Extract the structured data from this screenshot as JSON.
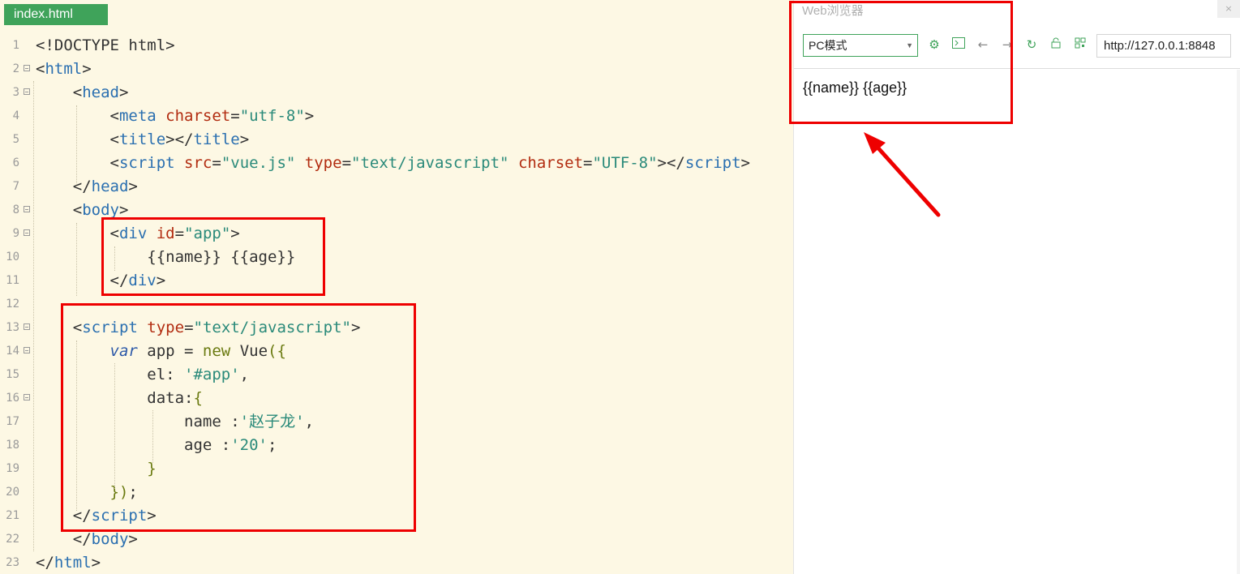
{
  "editor": {
    "tab_label": "index.html",
    "lines": [
      {
        "num": "1",
        "fold": false,
        "tokens": [
          {
            "c": "d",
            "t": "<!DOCTYPE html>"
          }
        ]
      },
      {
        "num": "2",
        "fold": true,
        "tokens": [
          {
            "c": "d",
            "t": "<"
          },
          {
            "c": "t",
            "t": "html"
          },
          {
            "c": "d",
            "t": ">"
          }
        ]
      },
      {
        "num": "3",
        "fold": true,
        "tokens": [
          {
            "c": "d",
            "t": "    <"
          },
          {
            "c": "t",
            "t": "head"
          },
          {
            "c": "d",
            "t": ">"
          }
        ]
      },
      {
        "num": "4",
        "fold": false,
        "tokens": [
          {
            "c": "d",
            "t": "        <"
          },
          {
            "c": "t",
            "t": "meta"
          },
          {
            "c": "d",
            "t": " "
          },
          {
            "c": "a",
            "t": "charset"
          },
          {
            "c": "d",
            "t": "="
          },
          {
            "c": "s",
            "t": "\"utf-8\""
          },
          {
            "c": "d",
            "t": ">"
          }
        ]
      },
      {
        "num": "5",
        "fold": false,
        "tokens": [
          {
            "c": "d",
            "t": "        <"
          },
          {
            "c": "t",
            "t": "title"
          },
          {
            "c": "d",
            "t": "></"
          },
          {
            "c": "t",
            "t": "title"
          },
          {
            "c": "d",
            "t": ">"
          }
        ]
      },
      {
        "num": "6",
        "fold": false,
        "tokens": [
          {
            "c": "d",
            "t": "        <"
          },
          {
            "c": "t",
            "t": "script"
          },
          {
            "c": "d",
            "t": " "
          },
          {
            "c": "a",
            "t": "src"
          },
          {
            "c": "d",
            "t": "="
          },
          {
            "c": "s",
            "t": "\"vue.js\""
          },
          {
            "c": "d",
            "t": " "
          },
          {
            "c": "a",
            "t": "type"
          },
          {
            "c": "d",
            "t": "="
          },
          {
            "c": "s",
            "t": "\"text/javascript\""
          },
          {
            "c": "d",
            "t": " "
          },
          {
            "c": "a",
            "t": "charset"
          },
          {
            "c": "d",
            "t": "="
          },
          {
            "c": "s",
            "t": "\"UTF-8\""
          },
          {
            "c": "d",
            "t": "></"
          },
          {
            "c": "t",
            "t": "script"
          },
          {
            "c": "d",
            "t": ">"
          }
        ]
      },
      {
        "num": "7",
        "fold": false,
        "tokens": [
          {
            "c": "d",
            "t": "    </"
          },
          {
            "c": "t",
            "t": "head"
          },
          {
            "c": "d",
            "t": ">"
          }
        ]
      },
      {
        "num": "8",
        "fold": true,
        "tokens": [
          {
            "c": "d",
            "t": "    <"
          },
          {
            "c": "t",
            "t": "body"
          },
          {
            "c": "d",
            "t": ">"
          }
        ]
      },
      {
        "num": "9",
        "fold": true,
        "tokens": [
          {
            "c": "d",
            "t": "        <"
          },
          {
            "c": "t",
            "t": "div"
          },
          {
            "c": "d",
            "t": " "
          },
          {
            "c": "a",
            "t": "id"
          },
          {
            "c": "d",
            "t": "="
          },
          {
            "c": "s",
            "t": "\"app\""
          },
          {
            "c": "d",
            "t": ">"
          }
        ]
      },
      {
        "num": "10",
        "fold": false,
        "tokens": [
          {
            "c": "d",
            "t": "            {{name}} {{age}}"
          }
        ]
      },
      {
        "num": "11",
        "fold": false,
        "tokens": [
          {
            "c": "d",
            "t": "        </"
          },
          {
            "c": "t",
            "t": "div"
          },
          {
            "c": "d",
            "t": ">"
          }
        ]
      },
      {
        "num": "12",
        "fold": false,
        "tokens": []
      },
      {
        "num": "13",
        "fold": true,
        "tokens": [
          {
            "c": "d",
            "t": "    <"
          },
          {
            "c": "t",
            "t": "script"
          },
          {
            "c": "d",
            "t": " "
          },
          {
            "c": "a",
            "t": "type"
          },
          {
            "c": "d",
            "t": "="
          },
          {
            "c": "s",
            "t": "\"text/javascript\""
          },
          {
            "c": "d",
            "t": ">"
          }
        ]
      },
      {
        "num": "14",
        "fold": true,
        "tokens": [
          {
            "c": "d",
            "t": "        "
          },
          {
            "c": "k",
            "t": "var"
          },
          {
            "c": "d",
            "t": " app = "
          },
          {
            "c": "p",
            "t": "new"
          },
          {
            "c": "d",
            "t": " Vue"
          },
          {
            "c": "p",
            "t": "({"
          }
        ]
      },
      {
        "num": "15",
        "fold": false,
        "tokens": [
          {
            "c": "d",
            "t": "            el: "
          },
          {
            "c": "s",
            "t": "'#app'"
          },
          {
            "c": "d",
            "t": ","
          }
        ]
      },
      {
        "num": "16",
        "fold": true,
        "tokens": [
          {
            "c": "d",
            "t": "            data:"
          },
          {
            "c": "p",
            "t": "{"
          }
        ]
      },
      {
        "num": "17",
        "fold": false,
        "tokens": [
          {
            "c": "d",
            "t": "                name :"
          },
          {
            "c": "s",
            "t": "'赵子龙'"
          },
          {
            "c": "d",
            "t": ","
          }
        ]
      },
      {
        "num": "18",
        "fold": false,
        "tokens": [
          {
            "c": "d",
            "t": "                age :"
          },
          {
            "c": "s",
            "t": "'20'"
          },
          {
            "c": "d",
            "t": ";"
          }
        ]
      },
      {
        "num": "19",
        "fold": false,
        "tokens": [
          {
            "c": "p",
            "t": "            }"
          }
        ]
      },
      {
        "num": "20",
        "fold": false,
        "tokens": [
          {
            "c": "p",
            "t": "        })"
          },
          {
            "c": "d",
            "t": ";"
          }
        ]
      },
      {
        "num": "21",
        "fold": false,
        "tokens": [
          {
            "c": "d",
            "t": "    </"
          },
          {
            "c": "t",
            "t": "script"
          },
          {
            "c": "d",
            "t": ">"
          }
        ]
      },
      {
        "num": "22",
        "fold": false,
        "tokens": [
          {
            "c": "d",
            "t": "    </"
          },
          {
            "c": "t",
            "t": "body"
          },
          {
            "c": "d",
            "t": ">"
          }
        ]
      },
      {
        "num": "23",
        "fold": false,
        "tokens": [
          {
            "c": "d",
            "t": "</"
          },
          {
            "c": "t",
            "t": "html"
          },
          {
            "c": "d",
            "t": ">"
          }
        ]
      }
    ]
  },
  "browser": {
    "title": "Web浏览器",
    "close_label": "×",
    "mode_value": "PC模式",
    "url_value": "http://127.0.0.1:8848",
    "rendered_text": "{{name}} {{age}}",
    "toolbar_icons": [
      "settings-icon",
      "console-icon",
      "back-icon",
      "forward-icon",
      "refresh-icon",
      "lock-icon",
      "qrcode-icon"
    ]
  },
  "colors": {
    "editor_bg": "#fdf8e4",
    "tag": "#2a6fb0",
    "attr": "#b22c10",
    "string": "#2a8a7a",
    "accent": "#3fa35a",
    "annotation": "#ee0000"
  }
}
